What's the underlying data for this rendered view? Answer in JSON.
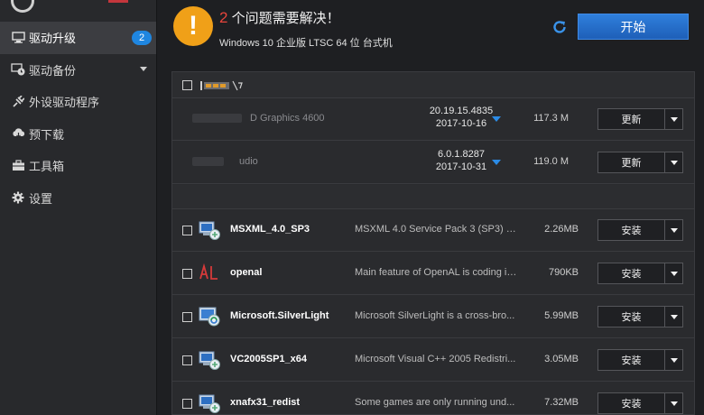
{
  "sidebar": {
    "items": [
      {
        "label": "驱动升级",
        "icon": "monitor-icon",
        "badge": "2"
      },
      {
        "label": "驱动备份",
        "icon": "backup-clock-icon"
      },
      {
        "label": "外设驱动程序",
        "icon": "plug-icon"
      },
      {
        "label": "预下载",
        "icon": "cloud-download-icon"
      },
      {
        "label": "工具箱",
        "icon": "toolbox-icon"
      },
      {
        "label": "设置",
        "icon": "gear-icon"
      }
    ]
  },
  "header": {
    "issue_count": "2",
    "issue_text": "个问题需要解决！",
    "os_info": "Windows 10 企业版 LTSC 64 位 台式机",
    "start_label": "开始"
  },
  "drivers": [
    {
      "name": "D Graphics 4600",
      "version": "20.19.15.4835",
      "date": "2017-10-16",
      "size": "117.3 M",
      "action": "更新"
    },
    {
      "name": "udio",
      "version": "6.0.1.8287",
      "date": "2017-10-31",
      "size": "119.0 M",
      "action": "更新"
    }
  ],
  "packages": [
    {
      "name": "MSXML_4.0_SP3",
      "desc": "MSXML 4.0 Service Pack 3 (SP3) tot...",
      "size": "2.26MB",
      "action": "安装",
      "icon": "installer-icon"
    },
    {
      "name": "openal",
      "desc": "Main feature of OpenAL is coding in...",
      "size": "790KB",
      "action": "安装",
      "icon": "openal-logo-icon"
    },
    {
      "name": "Microsoft.SilverLight",
      "desc": "Microsoft SilverLight is a cross-bro...",
      "size": "5.99MB",
      "action": "安装",
      "icon": "silverlight-installer-icon"
    },
    {
      "name": "VC2005SP1_x64",
      "desc": "Microsoft Visual C++ 2005 Redistri...",
      "size": "3.05MB",
      "action": "安装",
      "icon": "installer-icon"
    },
    {
      "name": "xnafx31_redist",
      "desc": "Some games are only running und...",
      "size": "7.32MB",
      "action": "安装",
      "icon": "installer-icon"
    }
  ],
  "colors": {
    "accent": "#1f86e0",
    "warning": "#f0a018",
    "count_red": "#e8453c"
  }
}
